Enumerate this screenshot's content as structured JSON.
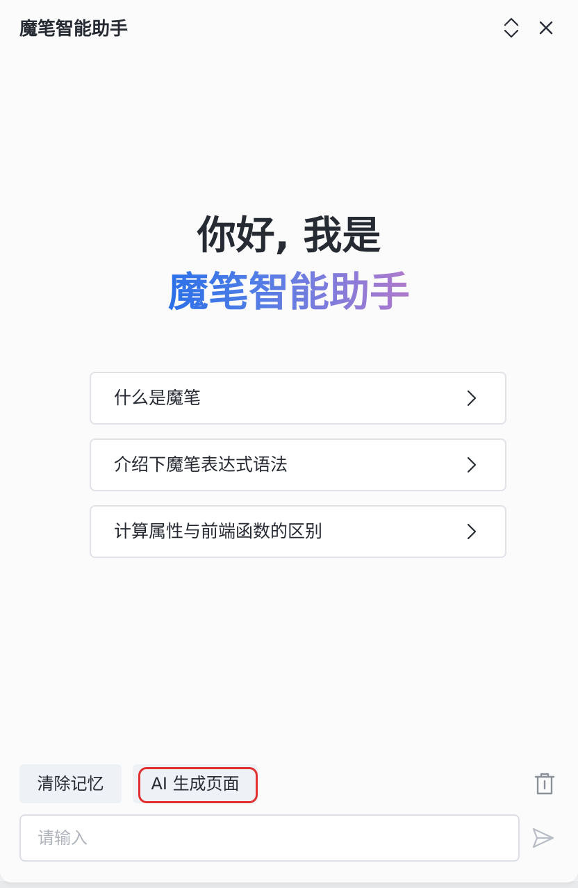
{
  "header": {
    "title": "魔笔智能助手",
    "expand_icon": "chevron-up-down-icon",
    "close_icon": "close-icon"
  },
  "welcome": {
    "greeting": "你好, 我是",
    "brand": "魔笔智能助手",
    "brand_gradient": [
      "#2a6fe8",
      "#8b7bd8",
      "#b07acb"
    ]
  },
  "suggestions": [
    {
      "label": "什么是魔笔",
      "icon": "chevron-right-icon"
    },
    {
      "label": "介绍下魔笔表达式语法",
      "icon": "chevron-right-icon"
    },
    {
      "label": "计算属性与前端函数的区别",
      "icon": "chevron-right-icon"
    }
  ],
  "toolbar": {
    "clear_memory_label": "清除记忆",
    "ai_generate_label": "AI 生成页面",
    "trash_icon": "trash-icon",
    "highlight_color": "#e12f2f"
  },
  "composer": {
    "placeholder": "请输入",
    "value": "",
    "send_icon": "send-icon"
  }
}
